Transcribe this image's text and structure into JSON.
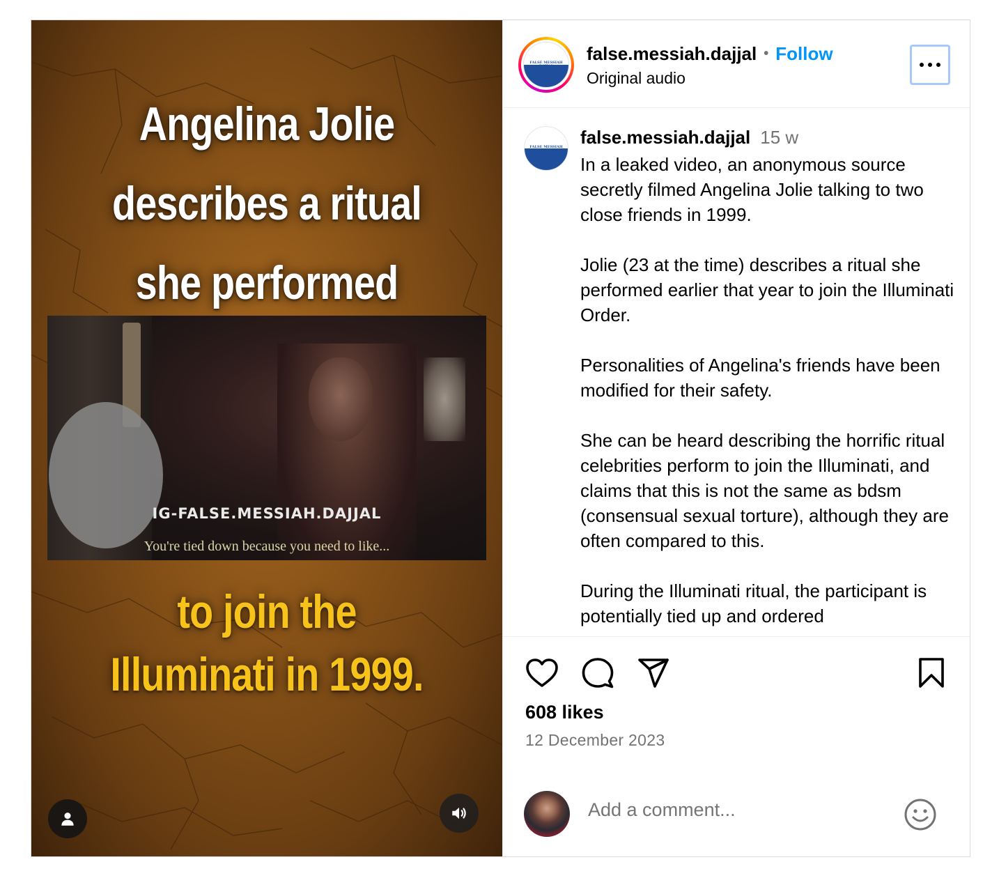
{
  "video": {
    "headline": [
      "Angelina Jolie",
      "describes a ritual",
      "she performed"
    ],
    "tagline": [
      "to join the",
      "Illuminati in 1999."
    ],
    "clip_watermark": "IG-FALSE.MESSIAH.DAJJAL",
    "clip_subtitle": "You're tied down because you need to like...",
    "user_icon": "user-icon",
    "sound_icon": "speaker-icon"
  },
  "header": {
    "username": "false.messiah.dajjal",
    "separator": "•",
    "follow_label": "Follow",
    "audio": "Original audio",
    "more_icon": "more-horizontal-icon",
    "avatar_text": "FALSE MESSIAH DAJJAL"
  },
  "caption": {
    "username": "false.messiah.dajjal",
    "age": "15 w",
    "paragraphs": [
      "In a leaked video, an anonymous source secretly filmed Angelina Jolie talking to two close friends in 1999.",
      "Jolie (23 at the time) describes a ritual she performed earlier that year to join the Illuminati Order.",
      "Personalities of Angelina's friends have been modified for their safety.",
      "She can be heard describing the horrific ritual celebrities perform to join the Illuminati, and claims that this is not the same as bdsm (consensual sexual torture), although they are often compared to this.",
      "During the Illuminati ritual, the participant is potentially tied up and ordered"
    ]
  },
  "actions": {
    "like_icon": "heart-icon",
    "comment_icon": "comment-icon",
    "share_icon": "send-icon",
    "save_icon": "bookmark-icon"
  },
  "stats": {
    "likes": "608 likes",
    "date": "12 December 2023"
  },
  "comment": {
    "placeholder": "Add a comment...",
    "emoji_icon": "emoji-icon"
  },
  "colors": {
    "follow": "#0095f6",
    "muted": "#737373",
    "tagline": "#f7c31b",
    "border": "#dbdbdb"
  }
}
